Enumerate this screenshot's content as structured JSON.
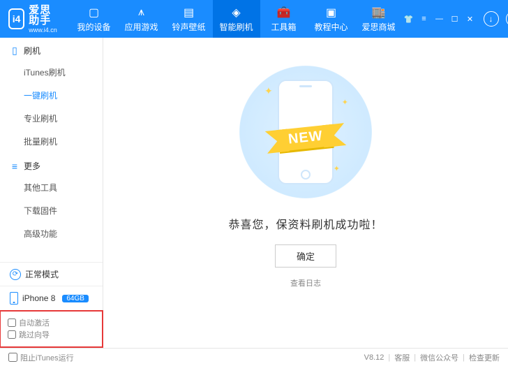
{
  "header": {
    "brand": "爱思助手",
    "url": "www.i4.cn",
    "tabs": [
      {
        "label": "我的设备",
        "icon": "▢"
      },
      {
        "label": "应用游戏",
        "icon": "⩚"
      },
      {
        "label": "铃声壁纸",
        "icon": "▤"
      },
      {
        "label": "智能刷机",
        "icon": "◈"
      },
      {
        "label": "工具箱",
        "icon": "🧰"
      },
      {
        "label": "教程中心",
        "icon": "▣"
      },
      {
        "label": "爱思商城",
        "icon": "🏬"
      }
    ],
    "active_tab_index": 3
  },
  "sidebar": {
    "sections": [
      {
        "title": "刷机",
        "icon": "phone",
        "items": [
          "iTunes刷机",
          "一键刷机",
          "专业刷机",
          "批量刷机"
        ],
        "active_index": 1
      },
      {
        "title": "更多",
        "icon": "list",
        "items": [
          "其他工具",
          "下载固件",
          "高级功能"
        ],
        "active_index": -1
      }
    ],
    "mode_label": "正常模式",
    "device_name": "iPhone 8",
    "device_capacity": "64GB",
    "check_auto_activate": "自动激活",
    "check_skip_guide": "跳过向导"
  },
  "main": {
    "badge_text": "NEW",
    "success_text": "恭喜您，保资料刷机成功啦！",
    "ok_label": "确定",
    "log_link": "查看日志"
  },
  "footer": {
    "block_itunes": "阻止iTunes运行",
    "version": "V8.12",
    "links": [
      "客服",
      "微信公众号",
      "检查更新"
    ]
  }
}
